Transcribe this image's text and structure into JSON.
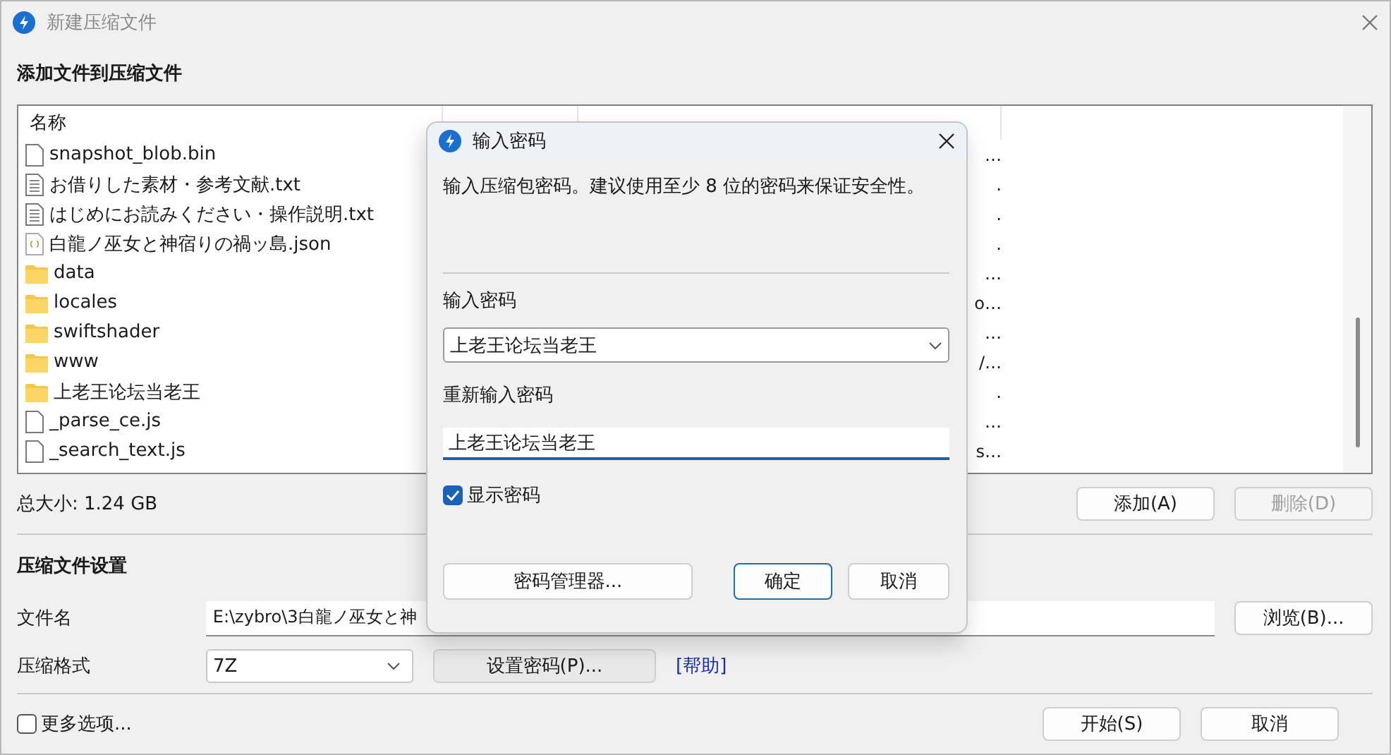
{
  "window": {
    "title": "新建压缩文件",
    "active": false
  },
  "add_section": {
    "title": "添加文件到压缩文件"
  },
  "file_list": {
    "columns": [
      "名称"
    ],
    "rows": [
      {
        "name": "snapshot_blob.bin",
        "kind": "file",
        "column_3": "…"
      },
      {
        "name": "お借りした素材・参考文献.txt",
        "kind": "text",
        "column_3": "."
      },
      {
        "name": "はじめにお読みください・操作説明.txt",
        "kind": "text",
        "column_3": "."
      },
      {
        "name": "白龍ノ巫女と神宿りの禍ッ島.json",
        "kind": "json",
        "column_3": "."
      },
      {
        "name": "data",
        "kind": "folder",
        "column_3": "…"
      },
      {
        "name": "locales",
        "kind": "folder",
        "column_3": "o…"
      },
      {
        "name": "swiftshader",
        "kind": "folder",
        "column_3": "…"
      },
      {
        "name": "www",
        "kind": "folder",
        "column_3": "/…"
      },
      {
        "name": "上老王论坛当老王",
        "kind": "folder",
        "column_3": "."
      },
      {
        "name": "_parse_ce.js",
        "kind": "file",
        "column_3": "…"
      },
      {
        "name": "_search_text.js",
        "kind": "file",
        "column_3": "s…"
      }
    ]
  },
  "total_size": "总大小: 1.24 GB",
  "list_buttons": [
    {
      "label": "添加(A)",
      "disabled": false
    },
    {
      "label": "删除(D)",
      "disabled": true
    }
  ],
  "settings": {
    "title": "压缩文件设置",
    "filename_label": "文件名",
    "filename": "E:\\zybro\\3白龍ノ巫女と神",
    "browse": "浏览(B)...",
    "format_label": "压缩格式",
    "format": "7Z",
    "password_button": "设置密码(P)...",
    "help_link": "[帮助]"
  },
  "more_options": {
    "label": "更多选项...",
    "checked": false
  },
  "bottom_buttons": [
    "开始(S)",
    "取消"
  ],
  "dialog": {
    "title": "输入密码",
    "message": "输入压缩包密码。建议使用至少 8 位的密码来保证安全性。",
    "password_label": "输入密码",
    "password": "上老王论坛当老王",
    "confirm_label": "重新输入密码",
    "confirm": "上老王论坛当老王",
    "show_password": {
      "label": "显示密码",
      "checked": true
    },
    "buttons": [
      {
        "label": "密码管理器...",
        "default": false
      },
      {
        "label": "确定",
        "default": true
      },
      {
        "label": "取消",
        "default": false
      }
    ]
  }
}
